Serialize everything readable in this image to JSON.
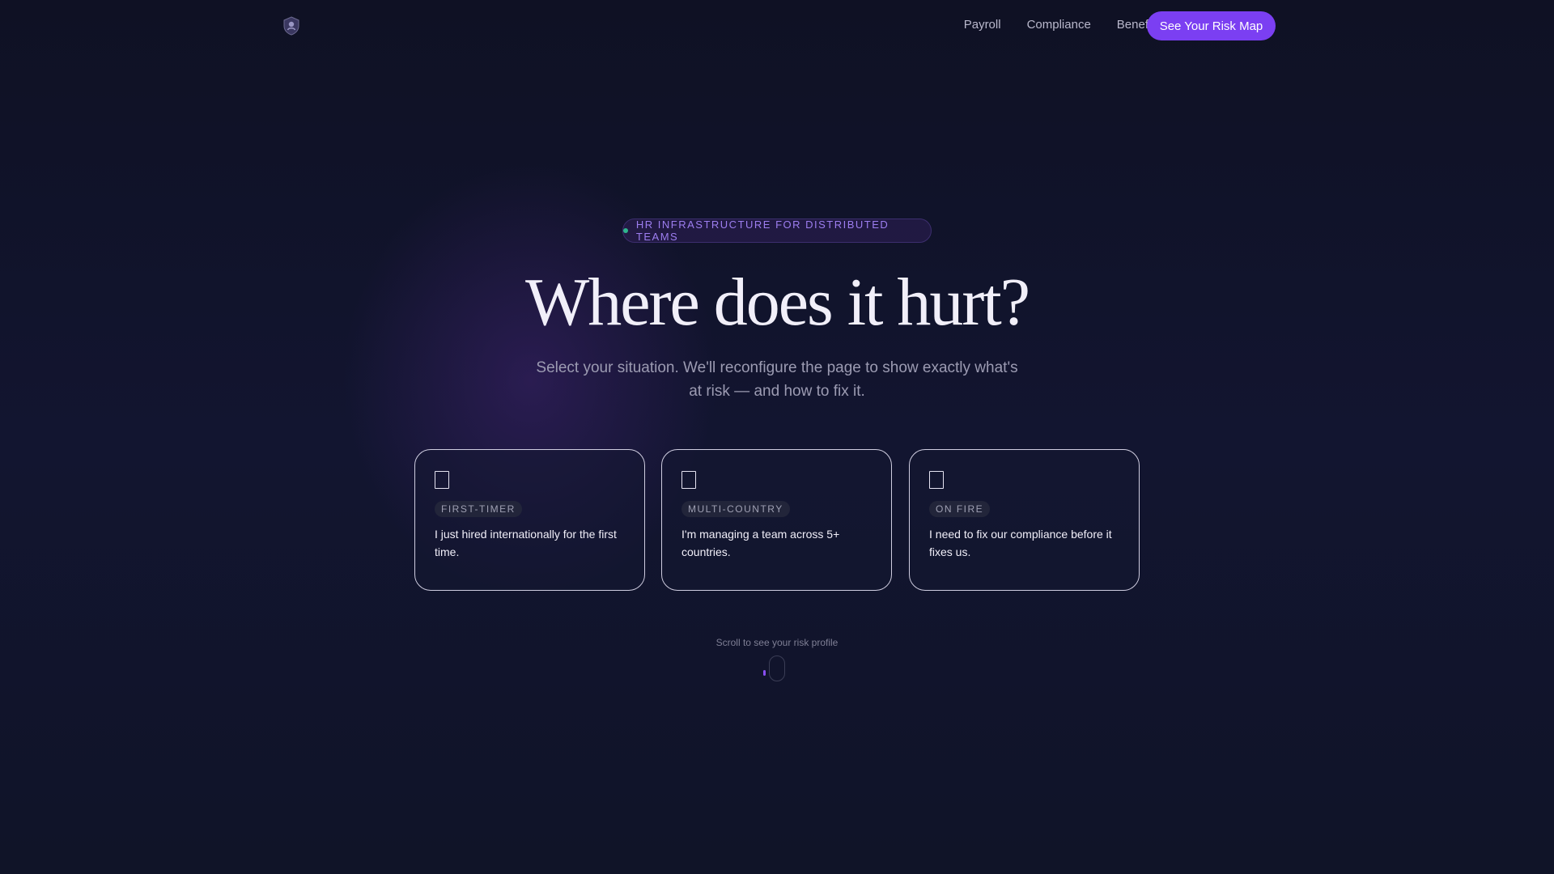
{
  "nav": {
    "logo_icon": "shield-logo-icon",
    "links": [
      {
        "label": "Payroll"
      },
      {
        "label": "Compliance"
      },
      {
        "label": "Benefits"
      }
    ],
    "cta_label": "See Your Risk Map"
  },
  "hero": {
    "eyebrow": "HR INFRASTRUCTURE FOR DISTRIBUTED TEAMS",
    "title": "Where does it hurt?",
    "subtitle": "Select your situation. We'll reconfigure the page to show exactly what's at risk — and how to fix it."
  },
  "cards": [
    {
      "icon": "card-icon",
      "tag": "FIRST-TIMER",
      "text": "I just hired internationally for the first time."
    },
    {
      "icon": "card-icon",
      "tag": "MULTI-COUNTRY",
      "text": "I'm managing a team across 5+ countries."
    },
    {
      "icon": "card-icon",
      "tag": "ON FIRE",
      "text": "I need to fix our compliance before it fixes us."
    }
  ],
  "scroll_hint": "Scroll to see your risk profile",
  "colors": {
    "background": "#0f1125",
    "accent": "#7b3ff2",
    "eyebrow_text": "#9d7ef0",
    "eyebrow_dot": "#2fb68e"
  }
}
